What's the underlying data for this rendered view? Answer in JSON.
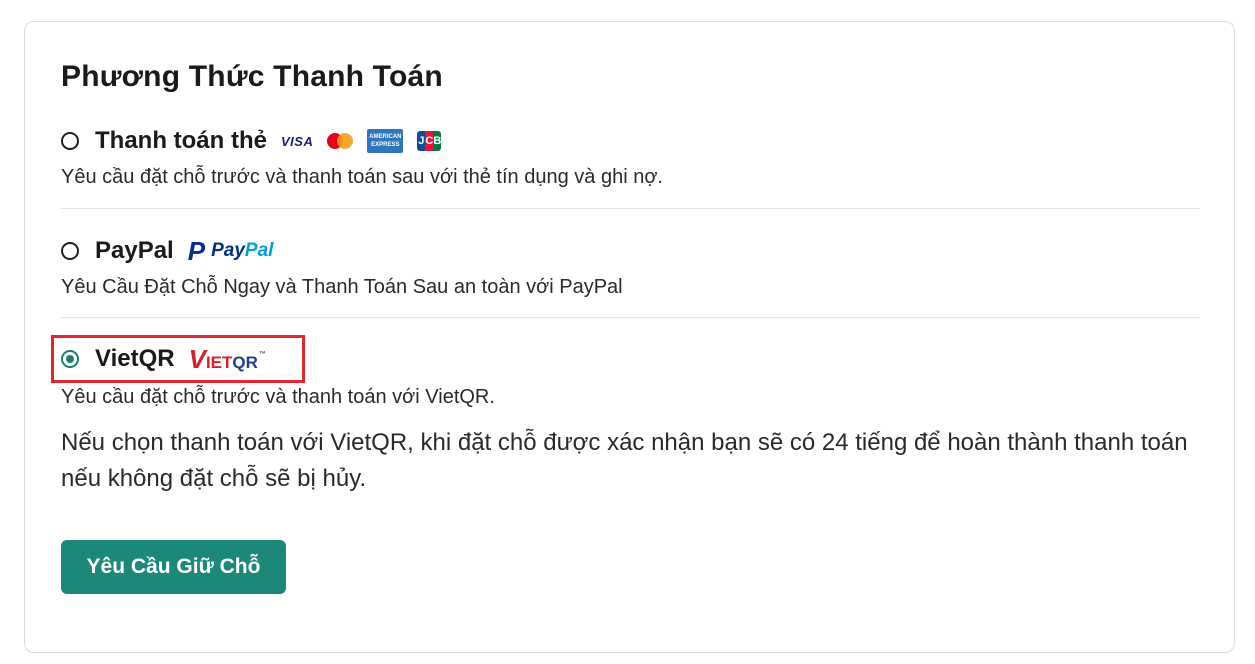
{
  "page": {
    "title": "Phương Thức Thanh Toán"
  },
  "options": [
    {
      "label": "Thanh toán thẻ",
      "description": "Yêu cầu đặt chỗ trước và thanh toán sau với thẻ tín dụng và ghi nợ.",
      "selected": false,
      "logos": [
        "visa-logo",
        "mastercard-logo",
        "amex-logo",
        "jcb-logo"
      ],
      "visa_text": "VISA",
      "amex_text_1": "AMERICAN",
      "amex_text_2": "EXPRESS",
      "jcb_letters": [
        "J",
        "C",
        "B"
      ]
    },
    {
      "label": "PayPal",
      "description": "Yêu Cầu Đặt Chỗ Ngay và Thanh Toán Sau an toàn với PayPal",
      "selected": false,
      "logo_mark": "P",
      "logo_pay": "Pay",
      "logo_pal": "Pal"
    },
    {
      "label": "VietQR",
      "description": "Yêu cầu đặt chỗ trước và thanh toán với VietQR.",
      "selected": true,
      "logo_v": "V",
      "logo_iet": "IET",
      "logo_qr": "QR",
      "logo_tm": "™"
    }
  ],
  "vietqr_note": "Nếu chọn thanh toán với VietQR, khi đặt chỗ được xác nhận bạn sẽ có 24 tiếng để hoàn thành thanh toán nếu không đặt chỗ sẽ bị hủy.",
  "submit_button": {
    "label": "Yêu Cầu Giữ Chỗ"
  },
  "colors": {
    "accent": "#1b887a",
    "highlight": "#e3262d",
    "radio_checked": "#1b7f73"
  }
}
